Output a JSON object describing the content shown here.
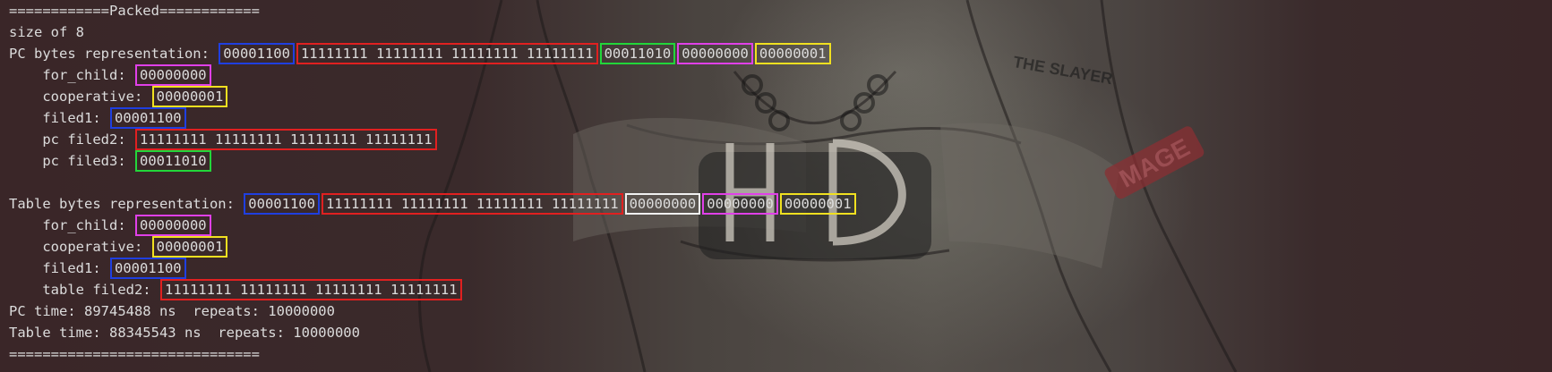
{
  "colors": {
    "background": "#3a2c2e",
    "text": "#dcdcdc",
    "box_blue": "#1f3fe0",
    "box_red": "#e02020",
    "box_green": "#22d63a",
    "box_magenta": "#e040e8",
    "box_yellow": "#f0e020",
    "box_white": "#f0f0f0"
  },
  "wallpaper": {
    "text_the_slayer": "THE SLAYER",
    "text_mage": "MAGE",
    "text_hd": "HD"
  },
  "output": {
    "header": "============Packed============",
    "size_line": "size of 8",
    "pc": {
      "label": "PC bytes representation: ",
      "b1": "00001100",
      "b2": "11111111 11111111 11111111 11111111",
      "b3": "00011010",
      "b4": "00000000",
      "b5": "00000001",
      "for_child_label": "    for_child: ",
      "for_child_value": "00000000",
      "cooperative_label": "    cooperative: ",
      "cooperative_value": "00000001",
      "filed1_label": "    filed1: ",
      "filed1_value": "00001100",
      "filed2_label": "    pc filed2: ",
      "filed2_value": "11111111 11111111 11111111 11111111",
      "filed3_label": "    pc filed3: ",
      "filed3_value": "00011010"
    },
    "table": {
      "label": "Table bytes representation: ",
      "b1": "00001100",
      "b2": "11111111 11111111 11111111 11111111",
      "b3": "00000000",
      "b4": "00000000",
      "b5": "00000001",
      "for_child_label": "    for_child: ",
      "for_child_value": "00000000",
      "cooperative_label": "    cooperative: ",
      "cooperative_value": "00000001",
      "filed1_label": "    filed1: ",
      "filed1_value": "00001100",
      "filed2_label": "    table filed2: ",
      "filed2_value": "11111111 11111111 11111111 11111111"
    },
    "pc_time": "PC time: 89745488 ns  repeats: 10000000",
    "table_time": "Table time: 88345543 ns  repeats: 10000000",
    "footer": "=============================="
  }
}
